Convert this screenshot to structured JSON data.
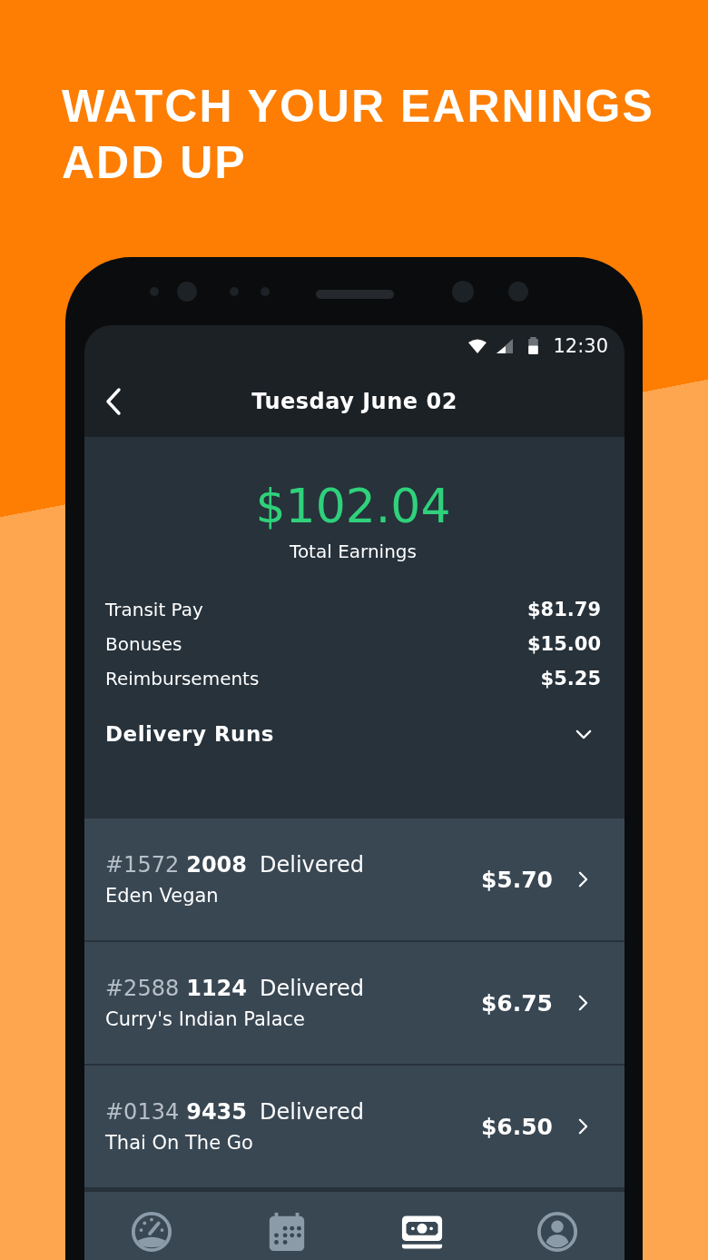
{
  "headline": "WATCH YOUR EARNINGS ADD UP",
  "status_bar": {
    "time": "12:30"
  },
  "app_bar": {
    "title": "Tuesday June 02"
  },
  "summary": {
    "total": "$102.04",
    "total_label": "Total Earnings",
    "breakdown": [
      {
        "label": "Transit Pay",
        "amount": "$81.79"
      },
      {
        "label": "Bonuses",
        "amount": "$15.00"
      },
      {
        "label": "Reimbursements",
        "amount": "$5.25"
      }
    ]
  },
  "delivery_runs": {
    "title": "Delivery Runs",
    "expanded": true,
    "runs": [
      {
        "order": "#1572",
        "code": "2008",
        "status": "Delivered",
        "restaurant": "Eden Vegan",
        "amount": "$5.70"
      },
      {
        "order": "#2588",
        "code": "1124",
        "status": "Delivered",
        "restaurant": "Curry's Indian Palace",
        "amount": "$6.75"
      },
      {
        "order": "#0134",
        "code": "9435",
        "status": "Delivered",
        "restaurant": "Thai On The Go",
        "amount": "$6.50"
      }
    ]
  },
  "bottom_nav": [
    {
      "kind": "speedometer",
      "selected": false
    },
    {
      "kind": "calendar",
      "selected": false
    },
    {
      "kind": "cash",
      "selected": true
    },
    {
      "kind": "profile",
      "selected": false
    }
  ]
}
